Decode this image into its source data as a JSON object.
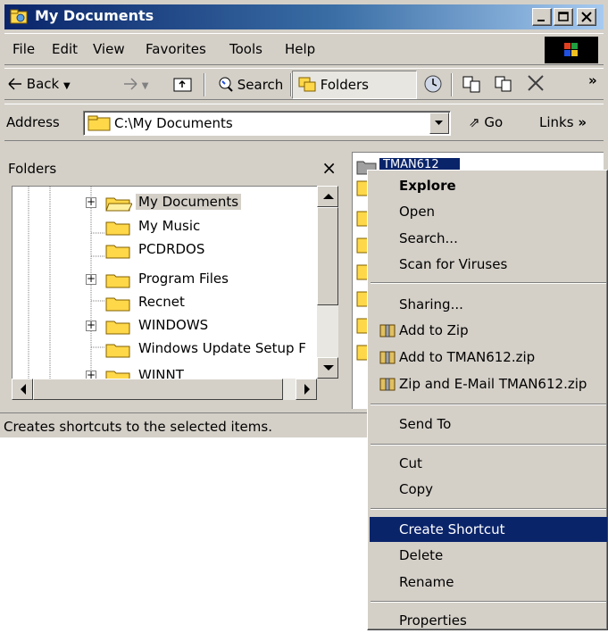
{
  "window": {
    "title": "My Documents"
  },
  "menu": [
    "File",
    "Edit",
    "View",
    "Favorites",
    "Tools",
    "Help"
  ],
  "toolbar": {
    "back": "Back",
    "search": "Search",
    "folders": "Folders"
  },
  "address": {
    "label": "Address",
    "value": "C:\\My Documents",
    "go": "Go",
    "links": "Links"
  },
  "folders_pane": {
    "title": "Folders",
    "close": "×",
    "items": [
      "My Documents",
      "My Music",
      "PCDRDOS",
      "Program Files",
      "Recnet",
      "WINDOWS",
      "Windows Update Setup F",
      "WINNT"
    ]
  },
  "file_pane": {
    "selected_item": "TMAN612"
  },
  "status": {
    "text": "Creates shortcuts to the selected items."
  },
  "context_menu": {
    "items": [
      "Explore",
      "Open",
      "Search...",
      "Scan for Viruses",
      "Sharing...",
      "Add to Zip",
      "Add to TMAN612.zip",
      "Zip and E-Mail TMAN612.zip",
      "Send To",
      "Cut",
      "Copy",
      "Create Shortcut",
      "Delete",
      "Rename",
      "Properties"
    ],
    "highlighted": "Create Shortcut"
  },
  "colors": {
    "title_start": "#0a246a",
    "title_end": "#a6caf0",
    "highlight": "#0a246a",
    "chrome": "#d4d0c8",
    "folder": "#ffd84a"
  },
  "icons": [
    "folder-icon",
    "back-arrow-icon",
    "forward-arrow-icon",
    "up-folder-icon",
    "search-icon",
    "folders-icon",
    "history-icon",
    "move-to-icon",
    "copy-to-icon",
    "delete-x-icon",
    "go-icon",
    "zip-icon",
    "windows-logo-icon"
  ]
}
